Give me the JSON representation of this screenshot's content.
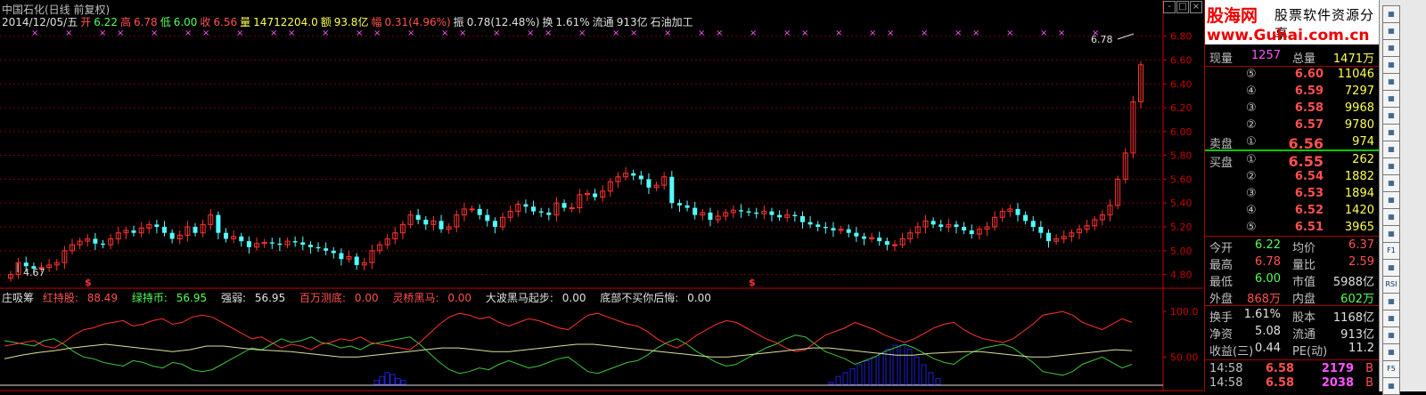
{
  "header": {
    "title": "中国石化(日线 前复权)",
    "date": "2014/12/05/五",
    "open_label": "开",
    "open": "6.22",
    "high_label": "高",
    "high": "6.78",
    "low_label": "低",
    "low": "6.00",
    "close_label": "收",
    "close": "6.56",
    "vol_label": "量",
    "vol": "14712204.0",
    "amt_label": "额",
    "amt": "93.8亿",
    "chg_label": "幅",
    "chg": "0.31(4.96%)",
    "amp_label": "振",
    "amp": "0.78(12.48%)",
    "turn_label": "换",
    "turn": "1.61%",
    "float_label": "流通",
    "float": "913亿",
    "industry": "石油加工"
  },
  "indicator": {
    "name": "庄吸筹",
    "red_label": "红持股:",
    "red_val": "88.49",
    "green_label": "绿持币:",
    "green_val": "56.95",
    "strong_label": "强弱:",
    "strong_val": "56.95",
    "million_label": "百万测底:",
    "million_val": "0.00",
    "bridge_label": "灵桥黑马:",
    "bridge_val": "0.00",
    "wave_label": "大波黑马起步:",
    "wave_val": "0.00",
    "bottom_label": "底部不买你后悔:",
    "bottom_val": "0.00"
  },
  "chart_data": {
    "type": "candlestick",
    "price_axis": {
      "ticks": [
        "6.80",
        "6.60",
        "6.40",
        "6.20",
        "6.00",
        "5.80",
        "5.60",
        "5.40",
        "5.20",
        "5.00",
        "4.80"
      ],
      "range": [
        4.7,
        6.85
      ]
    },
    "indicator_axis": {
      "ticks": [
        "100.0",
        "50.00"
      ]
    },
    "annotations": {
      "high_label": "6.78",
      "low_label": "4.67",
      "signal_marks": [
        "$",
        "$"
      ]
    },
    "closes": [
      4.8,
      4.9,
      4.87,
      4.85,
      4.86,
      4.88,
      4.9,
      5.0,
      5.05,
      5.08,
      5.1,
      5.06,
      5.05,
      5.1,
      5.15,
      5.17,
      5.15,
      5.19,
      5.22,
      5.2,
      5.15,
      5.1,
      5.13,
      5.2,
      5.15,
      5.22,
      5.3,
      5.15,
      5.1,
      5.12,
      5.08,
      5.03,
      5.06,
      5.07,
      5.06,
      5.05,
      5.08,
      5.07,
      5.05,
      5.03,
      5.02,
      5.0,
      4.98,
      4.93,
      4.95,
      4.88,
      4.9,
      5.0,
      5.05,
      5.1,
      5.15,
      5.22,
      5.3,
      5.26,
      5.22,
      5.25,
      5.18,
      5.2,
      5.3,
      5.35,
      5.35,
      5.3,
      5.25,
      5.2,
      5.28,
      5.33,
      5.39,
      5.37,
      5.33,
      5.32,
      5.3,
      5.4,
      5.36,
      5.36,
      5.47,
      5.48,
      5.45,
      5.5,
      5.58,
      5.62,
      5.65,
      5.63,
      5.6,
      5.53,
      5.55,
      5.62,
      5.4,
      5.38,
      5.36,
      5.3,
      5.32,
      5.26,
      5.29,
      5.32,
      5.34,
      5.33,
      5.32,
      5.31,
      5.33,
      5.3,
      5.28,
      5.3,
      5.29,
      5.24,
      5.22,
      5.2,
      5.19,
      5.17,
      5.18,
      5.15,
      5.12,
      5.1,
      5.11,
      5.08,
      5.05,
      5.05,
      5.1,
      5.15,
      5.2,
      5.25,
      5.22,
      5.2,
      5.22,
      5.2,
      5.17,
      5.14,
      5.18,
      5.2,
      5.28,
      5.33,
      5.35,
      5.3,
      5.25,
      5.2,
      5.15,
      5.08,
      5.1,
      5.12,
      5.15,
      5.18,
      5.21,
      5.26,
      5.3,
      5.38,
      5.6,
      5.82,
      6.25,
      6.56
    ],
    "red_line": [
      62,
      64,
      66,
      68,
      62,
      60,
      66,
      74,
      80,
      82,
      86,
      88,
      90,
      84,
      86,
      90,
      92,
      86,
      88,
      94,
      96,
      94,
      88,
      82,
      76,
      70,
      72,
      66,
      60,
      64,
      62,
      58,
      64,
      66,
      70,
      68,
      72,
      66,
      64,
      62,
      60,
      58,
      66,
      76,
      86,
      94,
      98,
      96,
      92,
      94,
      88,
      84,
      88,
      92,
      90,
      86,
      82,
      80,
      88,
      96,
      98,
      94,
      90,
      86,
      84,
      78,
      70,
      64,
      60,
      66,
      74,
      80,
      86,
      90,
      88,
      82,
      76,
      70,
      66,
      60,
      56,
      58,
      66,
      74,
      78,
      82,
      88,
      84,
      80,
      74,
      70,
      66,
      70,
      76,
      82,
      86,
      88,
      80,
      74,
      70,
      68,
      66,
      70,
      78,
      86,
      96,
      98,
      100,
      96,
      88,
      84,
      80,
      86,
      92,
      88
    ],
    "white_line": [
      48,
      52,
      55,
      57,
      60,
      62,
      64,
      62,
      60,
      58,
      56,
      58,
      62,
      62,
      60,
      58,
      57,
      56,
      54,
      52,
      50,
      50,
      52,
      54,
      56,
      58,
      60,
      60,
      58,
      56,
      56,
      58,
      60,
      62,
      64,
      64,
      62,
      60,
      58,
      56,
      54,
      52,
      50,
      50,
      52,
      54,
      56,
      58,
      60,
      60,
      58,
      56,
      54,
      52,
      52,
      54,
      55,
      56,
      56,
      54,
      52,
      50,
      50,
      52,
      54,
      56,
      58,
      57
    ],
    "volume_bars": [
      2,
      4,
      6,
      5,
      3,
      2,
      1,
      4,
      6,
      8,
      10,
      12,
      14,
      16,
      18,
      20,
      20,
      18,
      14,
      10,
      6,
      3
    ]
  },
  "quote": {
    "brand_line1": "股海网",
    "brand_tagline": "股票软件资源分享",
    "brand_line2": "www.Guhai.com.cn",
    "now_vol_label": "现量",
    "now_vol": "1257",
    "total_vol_label": "总量",
    "total_vol": "1471万",
    "asks": [
      {
        "idx": "⑤",
        "price": "6.60",
        "qty": "11046"
      },
      {
        "idx": "④",
        "price": "6.59",
        "qty": "7297"
      },
      {
        "idx": "③",
        "price": "6.58",
        "qty": "9968"
      },
      {
        "idx": "②",
        "price": "6.57",
        "qty": "9780"
      },
      {
        "idx": "①",
        "price": "6.56",
        "qty": "974"
      }
    ],
    "sell_label": "卖盘",
    "buy_label": "买盘",
    "bids": [
      {
        "idx": "①",
        "price": "6.55",
        "qty": "262"
      },
      {
        "idx": "②",
        "price": "6.54",
        "qty": "1882"
      },
      {
        "idx": "③",
        "price": "6.53",
        "qty": "1894"
      },
      {
        "idx": "④",
        "price": "6.52",
        "qty": "1420"
      },
      {
        "idx": "⑤",
        "price": "6.51",
        "qty": "3965"
      }
    ],
    "stats": [
      {
        "l1": "今开",
        "v1": "6.22",
        "c1": "green",
        "l2": "均价",
        "v2": "6.37",
        "c2": "red"
      },
      {
        "l1": "最高",
        "v1": "6.78",
        "c1": "red",
        "l2": "量比",
        "v2": "2.59",
        "c2": "red"
      },
      {
        "l1": "最低",
        "v1": "6.00",
        "c1": "green",
        "l2": "市值",
        "v2": "5988亿",
        "c2": "white"
      },
      {
        "l1": "外盘",
        "v1": "868万",
        "c1": "red",
        "l2": "内盘",
        "v2": "602万",
        "c2": "green"
      }
    ],
    "stats2": [
      {
        "l1": "换手",
        "v1": "1.61%",
        "l2": "股本",
        "v2": "1168亿"
      },
      {
        "l1": "净资",
        "v1": "5.08",
        "l2": "流通",
        "v2": "913亿"
      },
      {
        "l1": "收益(三)",
        "v1": "0.44",
        "l2": "PE(动)",
        "v2": "11.2"
      }
    ],
    "ticks": [
      {
        "time": "14:58",
        "price": "6.58",
        "vol": "2179",
        "side": "B"
      },
      {
        "time": "14:58",
        "price": "6.58",
        "vol": "2038",
        "side": "B"
      }
    ]
  },
  "toolbar": {
    "buttons": [
      "F1",
      "RSI",
      "F5"
    ]
  },
  "colors": {
    "up": "#ff3232",
    "down": "#54ffff",
    "grid": "#7a0000",
    "axis": "#c80000",
    "red_line": "#ff3232",
    "green_line": "#3cc83c",
    "white_line": "#e0e0a0",
    "vol_bar": "#2020d0"
  }
}
